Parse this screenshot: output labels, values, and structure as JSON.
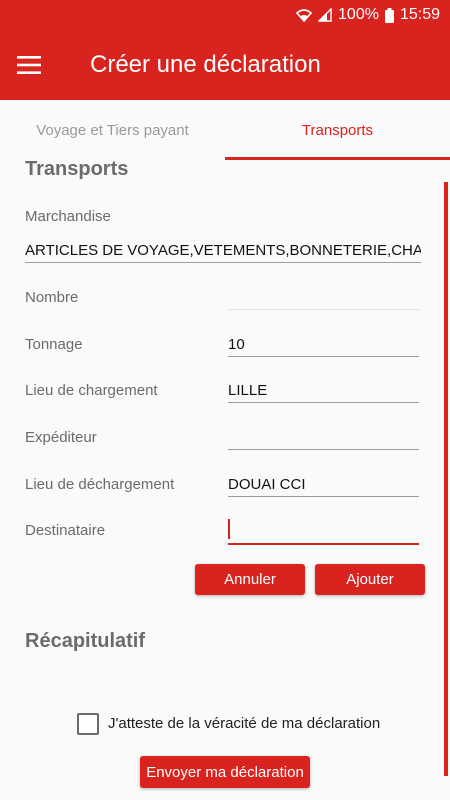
{
  "status_bar": {
    "battery": "100%",
    "time": "15:59",
    "icons": [
      "wifi-icon",
      "signal-icon",
      "battery-icon"
    ]
  },
  "app_bar": {
    "title": "Créer une déclaration",
    "menu_icon": "hamburger-menu-icon"
  },
  "tabs": [
    {
      "label": "Voyage et Tiers payant",
      "active": false
    },
    {
      "label": "Transports",
      "active": true
    }
  ],
  "transports": {
    "title": "Transports",
    "marchandise": {
      "label": "Marchandise",
      "value": "ARTICLES DE VOYAGE,VETEMENTS,BONNETERIE,CHAUSSU"
    },
    "fields": [
      {
        "label": "Nombre",
        "value": ""
      },
      {
        "label": "Tonnage",
        "value": "10"
      },
      {
        "label": "Lieu de chargement",
        "value": "LILLE"
      },
      {
        "label": "Expéditeur",
        "value": ""
      },
      {
        "label": "Lieu de déchargement",
        "value": "DOUAI CCI"
      },
      {
        "label": "Destinataire",
        "value": ""
      }
    ],
    "cancel_label": "Annuler",
    "add_label": "Ajouter"
  },
  "recap": {
    "title": "Récapitulatif",
    "attest_label": "J'atteste de la véracité de ma déclaration",
    "attest_checked": false,
    "send_label": "Envoyer ma déclaration"
  },
  "colors": {
    "accent": "#d9231f",
    "label": "#6b6b6b",
    "background": "#fafafa"
  }
}
